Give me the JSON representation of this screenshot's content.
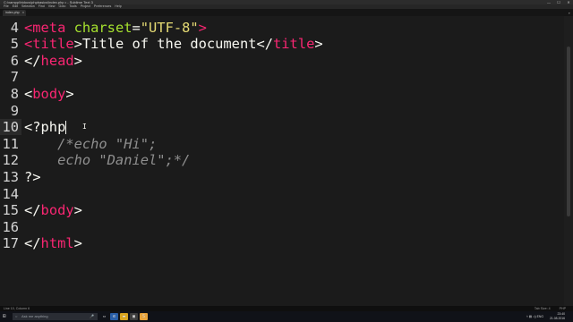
{
  "window": {
    "title": "C:\\xampp\\htdocs\\phpbasics\\index.php • - Sublime Text 3",
    "minimize": "—",
    "maximize": "☐",
    "close": "✕"
  },
  "menu": [
    "File",
    "Edit",
    "Selection",
    "Find",
    "View",
    "Goto",
    "Tools",
    "Project",
    "Preferences",
    "Help"
  ],
  "tabs": [
    {
      "label": "index.php",
      "active": true,
      "close": "×"
    }
  ],
  "tabs_overflow": "▾",
  "editor": {
    "current_line": "10",
    "lines": [
      {
        "num": "4",
        "seg": [
          [
            "tag",
            "<meta "
          ],
          [
            "attr",
            "charset"
          ],
          [
            "plain",
            "="
          ],
          [
            "str",
            "\"UTF-8\""
          ],
          [
            "tag",
            ">"
          ]
        ]
      },
      {
        "num": "5",
        "seg": [
          [
            "tag",
            "<"
          ],
          [
            "tag",
            "title"
          ],
          [
            "plain",
            ">Title of the document</"
          ],
          [
            "tag",
            "title"
          ],
          [
            "plain",
            ">"
          ]
        ]
      },
      {
        "num": "6",
        "seg": [
          [
            "plain",
            "</"
          ],
          [
            "tag",
            "head"
          ],
          [
            "plain",
            ">"
          ]
        ]
      },
      {
        "num": "7",
        "seg": []
      },
      {
        "num": "8",
        "seg": [
          [
            "plain",
            "<"
          ],
          [
            "tag",
            "body"
          ],
          [
            "plain",
            ">"
          ]
        ]
      },
      {
        "num": "9",
        "seg": []
      },
      {
        "num": "10",
        "seg": [
          [
            "plain",
            "<?php"
          ]
        ]
      },
      {
        "num": "11",
        "seg": [
          [
            "cmt",
            "    /*echo \"Hi\";"
          ]
        ]
      },
      {
        "num": "12",
        "seg": [
          [
            "cmt",
            "    echo \"Daniel\";*/"
          ]
        ]
      },
      {
        "num": "13",
        "seg": [
          [
            "plain",
            "?>"
          ]
        ]
      },
      {
        "num": "14",
        "seg": []
      },
      {
        "num": "15",
        "seg": [
          [
            "plain",
            "</"
          ],
          [
            "tag",
            "body"
          ],
          [
            "plain",
            ">"
          ]
        ]
      },
      {
        "num": "16",
        "seg": []
      },
      {
        "num": "17",
        "seg": [
          [
            "plain",
            "</"
          ],
          [
            "tag",
            "html"
          ],
          [
            "plain",
            ">"
          ]
        ]
      }
    ]
  },
  "status": {
    "position": "Line 10, Column 6",
    "tab_size": "Tab Size: 4",
    "syntax": "PHP"
  },
  "taskbar": {
    "search_placeholder": "Ask me anything",
    "time": "23:40",
    "date": "21.08.2016",
    "lang": "ENG"
  },
  "colors": {
    "background": "#1b1b1b",
    "tag": "#f92672",
    "attribute": "#a6e22e",
    "string": "#e6db74",
    "comment": "#8f8f8f"
  }
}
